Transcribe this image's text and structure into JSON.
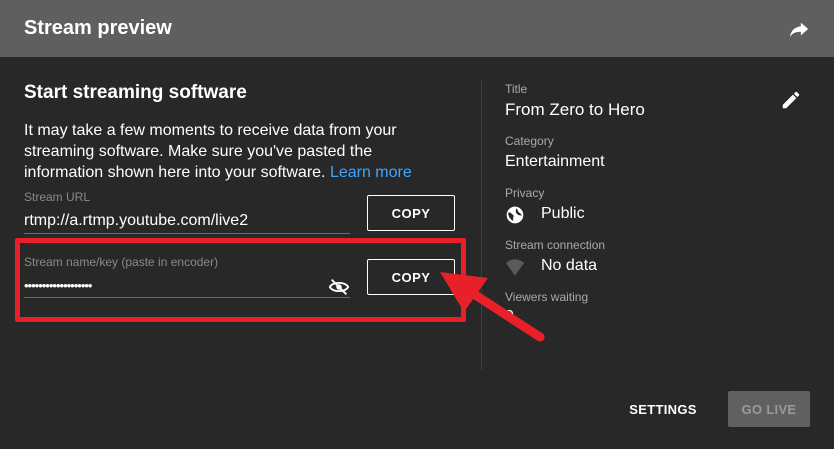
{
  "header": {
    "title": "Stream preview"
  },
  "section": {
    "title": "Start streaming software",
    "description": "It may take a few moments to receive data from your streaming software. Make sure you've pasted the information shown here into your software.",
    "learn_more": "Learn more"
  },
  "stream_url": {
    "label": "Stream URL",
    "value": "rtmp://a.rtmp.youtube.com/live2",
    "copy_label": "COPY"
  },
  "stream_key": {
    "label": "Stream name/key (paste in encoder)",
    "value": "•••••••••••••••••••",
    "copy_label": "COPY"
  },
  "details": {
    "title_label": "Title",
    "title_value": "From Zero to Hero",
    "category_label": "Category",
    "category_value": "Entertainment",
    "privacy_label": "Privacy",
    "privacy_value": "Public",
    "connection_label": "Stream connection",
    "connection_value": "No data",
    "viewers_label": "Viewers waiting",
    "viewers_value": "0"
  },
  "footer": {
    "settings_label": "SETTINGS",
    "golive_label": "GO LIVE"
  },
  "icons": {
    "share": "share-arrow-icon",
    "eye_off": "eye-off-icon",
    "edit": "pencil-icon",
    "globe": "globe-icon",
    "signal": "signal-icon"
  },
  "colors": {
    "header_bg": "#5f5f5f",
    "body_bg": "#282828",
    "link": "#3ea6ff",
    "highlight": "#e8202a"
  }
}
